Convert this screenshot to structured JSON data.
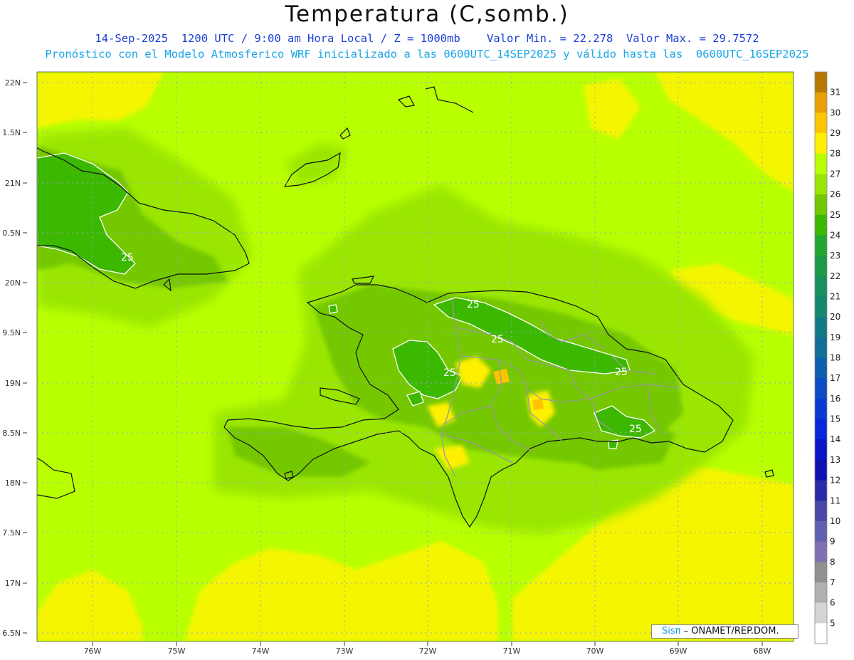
{
  "header": {
    "title": "Temperatura (C,somb.)",
    "line1": "14-Sep-2025  1200 UTC / 9:00 am Hora Local / Z = 1000mb    Valor Min. = 22.278  Valor Max. = 29.7572",
    "line2": "Pronóstico con el Modelo Atmosferico WRF inicializado a las 0600UTC_14SEP2025 y válido hasta las  0600UTC_16SEP2025"
  },
  "map": {
    "lat_labels": [
      "22N",
      "1.5N",
      "21N",
      "0.5N",
      "20N",
      "9.5N",
      "19N",
      "8.5N",
      "18N",
      "7.5N",
      "17N",
      "6.5N"
    ],
    "lon_labels": [
      "76W",
      "75W",
      "74W",
      "73W",
      "72W",
      "71W",
      "70W",
      "69W",
      "68W"
    ],
    "contour_labels": [
      "25",
      "25",
      "25",
      "25",
      "25",
      "25"
    ]
  },
  "colorbar": {
    "labels": [
      "31",
      "30",
      "29",
      "28",
      "27",
      "26",
      "25",
      "24",
      "23",
      "22",
      "21",
      "20",
      "19",
      "18",
      "17",
      "16",
      "15",
      "14",
      "13",
      "12",
      "11",
      "10",
      "9",
      "8",
      "7",
      "6",
      "5"
    ],
    "colors": [
      "#b87800",
      "#e8a000",
      "#ffc400",
      "#fff000",
      "#b8ff00",
      "#9ae600",
      "#74c800",
      "#3cb800",
      "#22a832",
      "#1c9a48",
      "#16905e",
      "#148870",
      "#127a84",
      "#106e98",
      "#0f5eb0",
      "#0d4cc4",
      "#0a3ad4",
      "#0828dc",
      "#0a14c8",
      "#1010b0",
      "#2a2aa8",
      "#4848a8",
      "#6060b0",
      "#8070b0",
      "#909090",
      "#b0b0b0",
      "#d4d4d4",
      "#ffffff"
    ]
  },
  "credit": {
    "logo": "Sisπ",
    "text": "– ONAMET/REP.DOM."
  }
}
